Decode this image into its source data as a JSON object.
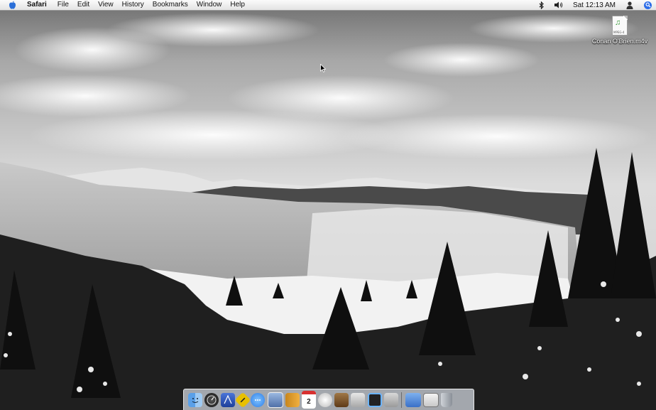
{
  "menubar": {
    "apple_icon": "apple-icon",
    "app_name": "Safari",
    "menus": [
      "File",
      "Edit",
      "View",
      "History",
      "Bookmarks",
      "Window",
      "Help"
    ],
    "status_icons": [
      "bluetooth-icon",
      "volume-icon"
    ],
    "clock": "Sat 12:13 AM",
    "user_icon": "user-icon",
    "spotlight_icon": "spotlight-icon"
  },
  "desktop": {
    "wallpaper": "black-and-white mountain landscape with snowy pine trees",
    "icon": {
      "label": "Conan O'Brien.m4v",
      "file_type_text": "MPEG-4",
      "icon": "video-file-icon"
    }
  },
  "dock": {
    "apps": [
      "finder-icon",
      "dashboard-icon",
      "mail-icon",
      "safari-icon",
      "ichat-icon",
      "preview-icon",
      "address-book-icon",
      "ical-icon",
      "itunes-icon",
      "iphoto-icon",
      "imovie-icon",
      "photo-booth-icon",
      "system-preferences-icon"
    ],
    "docs": [
      "downloads-stack-icon",
      "documents-stack-icon",
      "trash-icon"
    ]
  },
  "colors": {
    "menubar_bg": "#ececec",
    "spotlight_blue": "#2d6ee8",
    "dock_bg": "#d7dce4"
  }
}
